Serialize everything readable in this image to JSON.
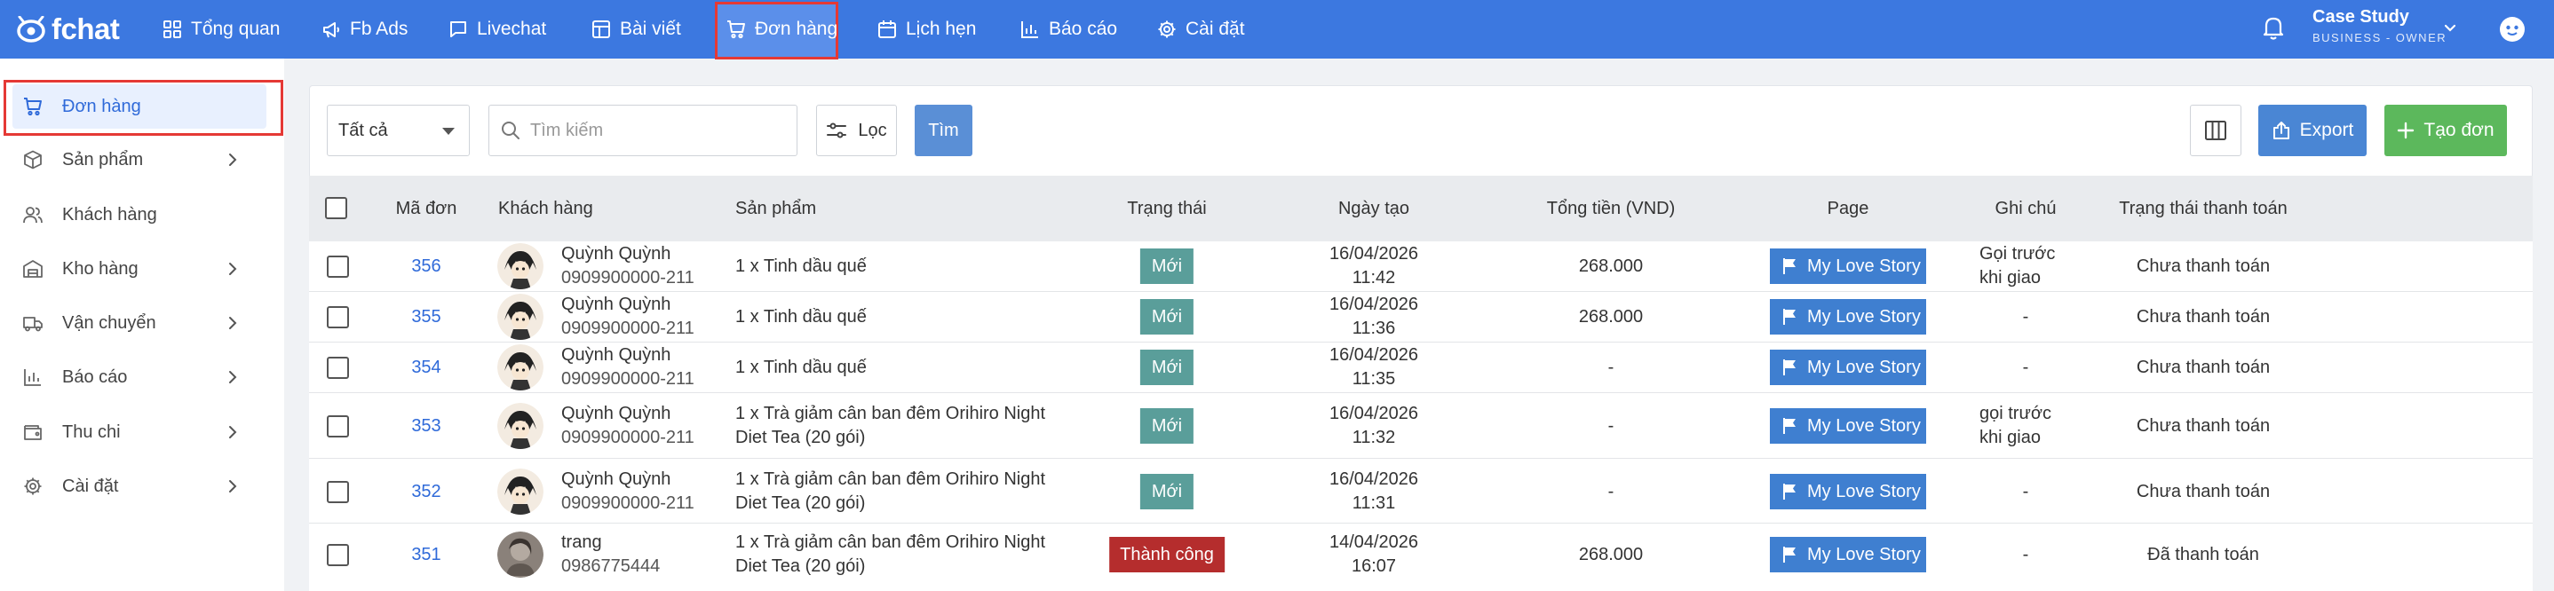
{
  "brand": {
    "logo_text": "fchat"
  },
  "topnav": {
    "items": [
      {
        "label": "Tổng quan",
        "icon": "grid-icon"
      },
      {
        "label": "Fb Ads",
        "icon": "megaphone-icon"
      },
      {
        "label": "Livechat",
        "icon": "chat-icon"
      },
      {
        "label": "Bài viết",
        "icon": "layout-icon"
      },
      {
        "label": "Đơn hàng",
        "icon": "cart-icon",
        "active": true
      },
      {
        "label": "Lịch hẹn",
        "icon": "calendar-icon"
      },
      {
        "label": "Báo cáo",
        "icon": "bar-chart-icon"
      },
      {
        "label": "Cài đặt",
        "icon": "gear-icon"
      }
    ],
    "user_name": "Case Study",
    "user_role": "BUSINESS - OWNER"
  },
  "sidebar": {
    "items": [
      {
        "label": "Đơn hàng",
        "icon": "cart-icon",
        "active": true,
        "has_children": false
      },
      {
        "label": "Sản phẩm",
        "icon": "box-icon",
        "has_children": true
      },
      {
        "label": "Khách hàng",
        "icon": "users-icon",
        "has_children": false
      },
      {
        "label": "Kho hàng",
        "icon": "warehouse-icon",
        "has_children": true
      },
      {
        "label": "Vận chuyển",
        "icon": "truck-icon",
        "has_children": true
      },
      {
        "label": "Báo cáo",
        "icon": "bar-chart-icon",
        "has_children": true
      },
      {
        "label": "Thu chi",
        "icon": "wallet-icon",
        "has_children": true
      },
      {
        "label": "Cài đặt",
        "icon": "gear-icon",
        "has_children": true
      }
    ]
  },
  "toolbar": {
    "status_select": "Tất cả",
    "search_placeholder": "Tìm kiếm",
    "filter_label": "Lọc",
    "find_label": "Tìm",
    "export_label": "Export",
    "create_label": "Tạo đơn"
  },
  "table": {
    "columns": [
      "Mã đơn",
      "Khách hàng",
      "Sản phẩm",
      "Trạng thái",
      "Ngày tạo",
      "Tổng tiền (VND)",
      "Page",
      "Ghi chú",
      "Trạng thái thanh toán"
    ],
    "rows": [
      {
        "id": "356",
        "customer": "Quỳnh Quỳnh",
        "phone": "0909900000-211",
        "product": [
          "1 x Tinh dầu quế"
        ],
        "status": "Mới",
        "date": "16/04/2026",
        "time": "11:42",
        "total": "268.000",
        "page": "My Love Story",
        "note": [
          "Gọi trước",
          "khi giao"
        ],
        "payment": "Chưa thanh toán",
        "avatar": "cartoon"
      },
      {
        "id": "355",
        "customer": "Quỳnh Quỳnh",
        "phone": "0909900000-211",
        "product": [
          "1 x Tinh dầu quế"
        ],
        "status": "Mới",
        "date": "16/04/2026",
        "time": "11:36",
        "total": "268.000",
        "page": "My Love Story",
        "note": [
          "-"
        ],
        "payment": "Chưa thanh toán",
        "avatar": "cartoon"
      },
      {
        "id": "354",
        "customer": "Quỳnh Quỳnh",
        "phone": "0909900000-211",
        "product": [
          "1 x Tinh dầu quế"
        ],
        "status": "Mới",
        "date": "16/04/2026",
        "time": "11:35",
        "total": "-",
        "page": "My Love Story",
        "note": [
          "-"
        ],
        "payment": "Chưa thanh toán",
        "avatar": "cartoon"
      },
      {
        "id": "353",
        "customer": "Quỳnh Quỳnh",
        "phone": "0909900000-211",
        "product": [
          "1 x Trà giảm cân ban đêm Orihiro Night",
          "Diet Tea (20 gói)"
        ],
        "status": "Mới",
        "date": "16/04/2026",
        "time": "11:32",
        "total": "-",
        "page": "My Love Story",
        "note": [
          "gọi trước",
          "khi giao"
        ],
        "payment": "Chưa thanh toán",
        "avatar": "cartoon"
      },
      {
        "id": "352",
        "customer": "Quỳnh Quỳnh",
        "phone": "0909900000-211",
        "product": [
          "1 x Trà giảm cân ban đêm Orihiro Night",
          "Diet Tea (20 gói)"
        ],
        "status": "Mới",
        "date": "16/04/2026",
        "time": "11:31",
        "total": "-",
        "page": "My Love Story",
        "note": [
          "-"
        ],
        "payment": "Chưa thanh toán",
        "avatar": "cartoon"
      },
      {
        "id": "351",
        "customer": "trang",
        "phone": "0986775444",
        "product": [
          "1 x Trà giảm cân ban đêm Orihiro Night",
          "Diet Tea (20 gói)"
        ],
        "status": "Thành công",
        "date": "14/04/2026",
        "time": "16:07",
        "total": "268.000",
        "page": "My Love Story",
        "note": [
          "-"
        ],
        "payment": "Đã thanh toán",
        "avatar": "photo"
      }
    ]
  },
  "colors": {
    "nav_bg": "#3c78e0",
    "status_new": "#5a9e9a",
    "status_success": "#b52d2d",
    "page_tag": "#3f7fd0",
    "create_btn": "#5cb85c",
    "highlight_box": "#e53935"
  }
}
